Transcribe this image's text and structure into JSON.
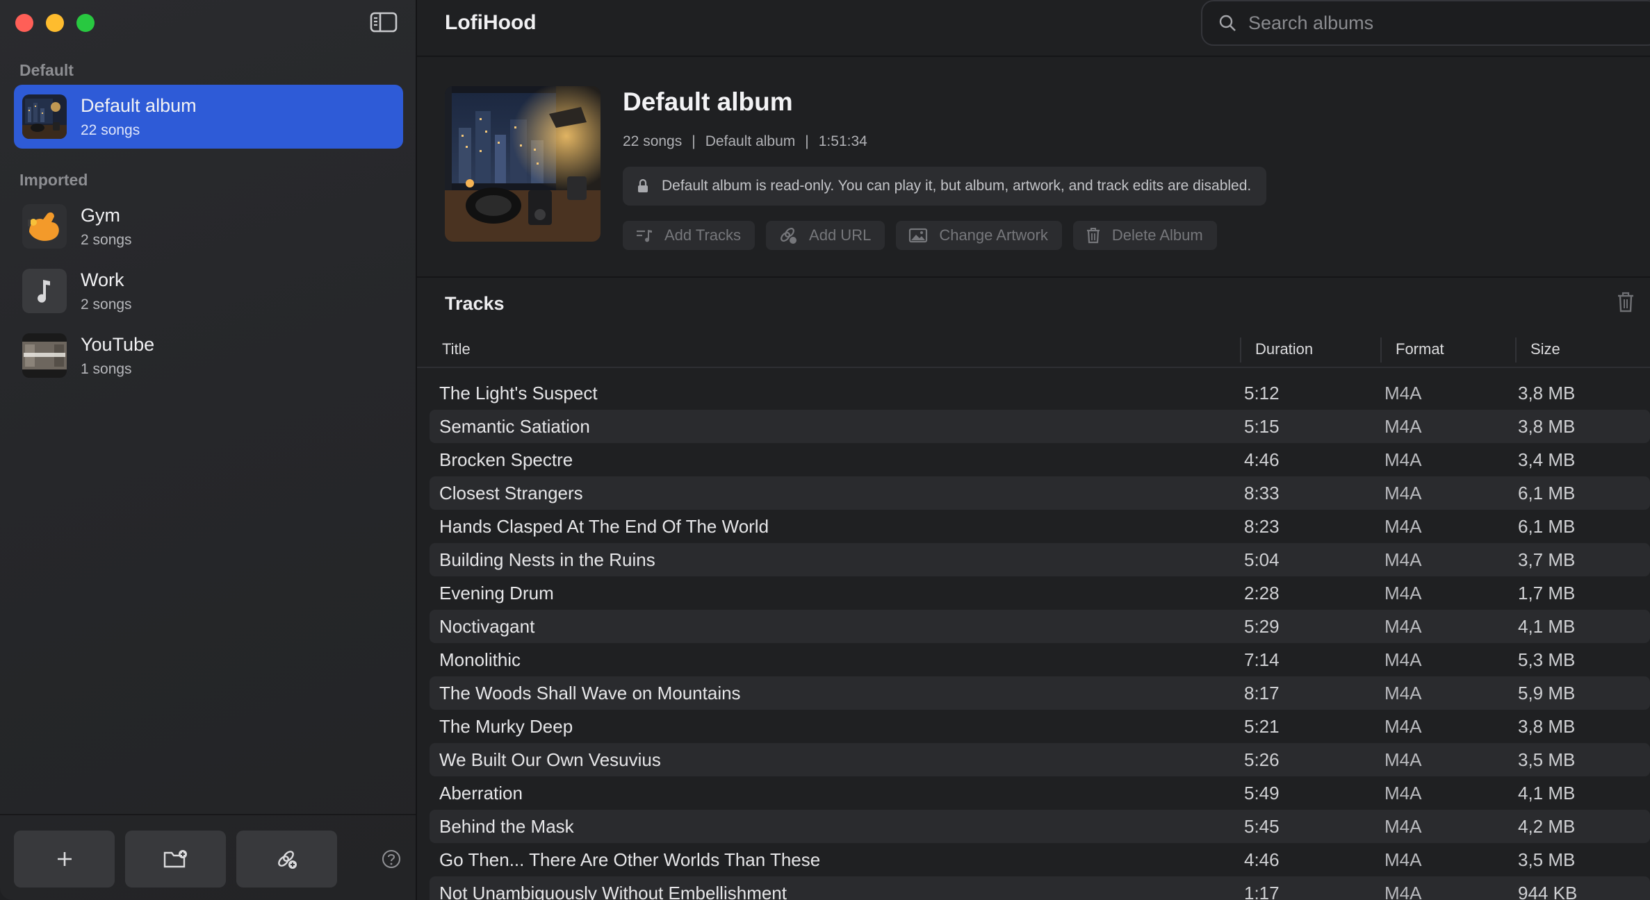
{
  "window": {
    "controls": [
      "close",
      "minimize",
      "zoom"
    ]
  },
  "sidebar": {
    "default_section": "Default",
    "imported_section": "Imported",
    "selected_album": {
      "name": "Default album",
      "count": "22 songs",
      "thumb_icon": "night-city-artwork"
    },
    "imported_albums": [
      {
        "name": "Gym",
        "count": "2 songs",
        "thumb_icon": "flexing-arm-icon"
      },
      {
        "name": "Work",
        "count": "2 songs",
        "thumb_icon": "music-note-icon"
      },
      {
        "name": "YouTube",
        "count": "1 songs",
        "thumb_icon": "video-thumbnail"
      }
    ],
    "bottom_buttons": [
      "plus-icon",
      "folder-add-icon",
      "link-add-icon"
    ],
    "help_icon": "question-circle-icon"
  },
  "app": {
    "title": "LofiHood"
  },
  "search": {
    "placeholder": "Search albums",
    "value": ""
  },
  "album": {
    "title": "Default album",
    "meta_count": "22 songs",
    "meta_sep": "|",
    "meta_album": "Default album",
    "meta_duration": "1:51:34",
    "readonly_note": "Default album is read-only. You can play it, but album, artwork, and track edits are disabled.",
    "actions": {
      "add_tracks": "Add Tracks",
      "add_url": "Add URL",
      "change_artwork": "Change Artwork",
      "delete_album": "Delete Album"
    }
  },
  "tracks": {
    "heading": "Tracks",
    "columns": {
      "title": "Title",
      "duration": "Duration",
      "format": "Format",
      "size": "Size"
    },
    "rows": [
      {
        "title": "The Light's Suspect",
        "duration": "5:12",
        "format": "M4A",
        "size": "3,8 MB"
      },
      {
        "title": "Semantic Satiation",
        "duration": "5:15",
        "format": "M4A",
        "size": "3,8 MB"
      },
      {
        "title": "Brocken Spectre",
        "duration": "4:46",
        "format": "M4A",
        "size": "3,4 MB"
      },
      {
        "title": "Closest Strangers",
        "duration": "8:33",
        "format": "M4A",
        "size": "6,1 MB"
      },
      {
        "title": "Hands Clasped At The End Of The World",
        "duration": "8:23",
        "format": "M4A",
        "size": "6,1 MB"
      },
      {
        "title": "Building Nests in the Ruins",
        "duration": "5:04",
        "format": "M4A",
        "size": "3,7 MB"
      },
      {
        "title": "Evening Drum",
        "duration": "2:28",
        "format": "M4A",
        "size": "1,7 MB"
      },
      {
        "title": "Noctivagant",
        "duration": "5:29",
        "format": "M4A",
        "size": "4,1 MB"
      },
      {
        "title": "Monolithic",
        "duration": "7:14",
        "format": "M4A",
        "size": "5,3 MB"
      },
      {
        "title": "The Woods Shall Wave on Mountains",
        "duration": "8:17",
        "format": "M4A",
        "size": "5,9 MB"
      },
      {
        "title": "The Murky Deep",
        "duration": "5:21",
        "format": "M4A",
        "size": "3,8 MB"
      },
      {
        "title": "We Built Our Own Vesuvius",
        "duration": "5:26",
        "format": "M4A",
        "size": "3,5 MB"
      },
      {
        "title": "Aberration",
        "duration": "5:49",
        "format": "M4A",
        "size": "4,1 MB"
      },
      {
        "title": "Behind the Mask",
        "duration": "5:45",
        "format": "M4A",
        "size": "4,2 MB"
      },
      {
        "title": "Go Then... There Are Other Worlds Than These",
        "duration": "4:46",
        "format": "M4A",
        "size": "3,5 MB"
      },
      {
        "title": "Not Unambiguously Without Embellishment",
        "duration": "1:17",
        "format": "M4A",
        "size": "944 KB"
      }
    ]
  },
  "colors": {
    "accent": "#2e5bd7",
    "sidebar_bg": "#27282b",
    "main_bg": "#1f2022",
    "row_alt": "#2a2b2e",
    "close": "#ff5f57",
    "minimize": "#febc2e",
    "zoom": "#28c840"
  }
}
